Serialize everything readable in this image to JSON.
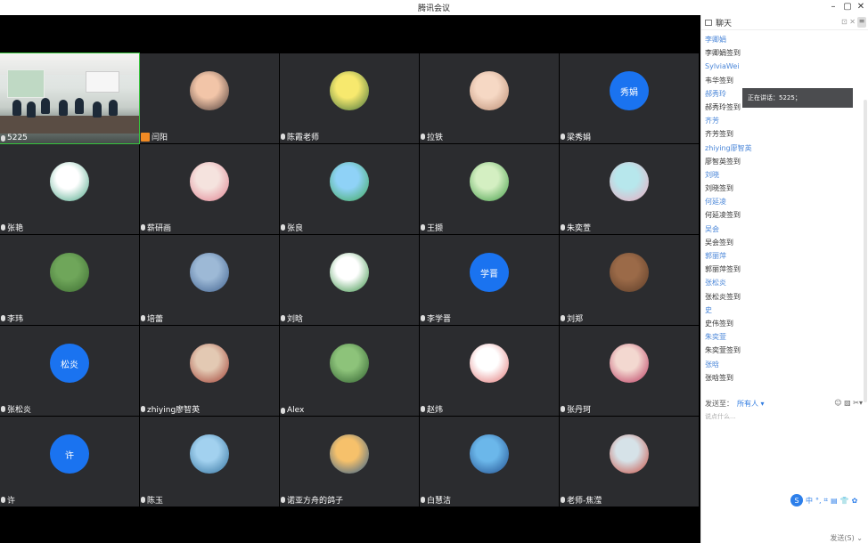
{
  "window": {
    "title": "腾讯会议",
    "min": "–",
    "max": "▢",
    "close": "✕"
  },
  "participants": [
    {
      "name": "5225",
      "kind": "camera"
    },
    {
      "name": "闫阳",
      "kind": "photo",
      "colors": [
        "#f2c5a8",
        "#4a3a37"
      ],
      "host": true
    },
    {
      "name": "陈霞老师",
      "kind": "photo",
      "colors": [
        "#f7e96e",
        "#3d6e3a"
      ]
    },
    {
      "name": "拉铁",
      "kind": "photo",
      "colors": [
        "#f6d8c4",
        "#b98b72"
      ]
    },
    {
      "name": "梁秀娟",
      "kind": "text",
      "text": "秀娟"
    },
    {
      "name": "张艳",
      "kind": "photo",
      "colors": [
        "#ffffff",
        "#45a483"
      ]
    },
    {
      "name": "薪研画",
      "kind": "photo",
      "colors": [
        "#f5e3de",
        "#e07e8e"
      ]
    },
    {
      "name": "张良",
      "kind": "photo",
      "colors": [
        "#8fd2f7",
        "#3da854"
      ]
    },
    {
      "name": "王撷",
      "kind": "photo",
      "colors": [
        "#d4efc2",
        "#3e9a43"
      ]
    },
    {
      "name": "朱奕萱",
      "kind": "photo",
      "colors": [
        "#b7e7ec",
        "#eea8be"
      ]
    },
    {
      "name": "李玮",
      "kind": "photo",
      "colors": [
        "#6fa65a",
        "#3b6b30"
      ]
    },
    {
      "name": "培蕾",
      "kind": "photo",
      "colors": [
        "#9db9d6",
        "#3d5f8d"
      ]
    },
    {
      "name": "刘晗",
      "kind": "photo",
      "colors": [
        "#ffffff",
        "#2f8c3c"
      ]
    },
    {
      "name": "李学晋",
      "kind": "text",
      "text": "学晋"
    },
    {
      "name": "刘郑",
      "kind": "photo",
      "colors": [
        "#9b6a48",
        "#5a3b27"
      ]
    },
    {
      "name": "张松炎",
      "kind": "text",
      "text": "松炎"
    },
    {
      "name": "zhiying廖智英",
      "kind": "photo",
      "colors": [
        "#e3c9b3",
        "#9e3a2f"
      ]
    },
    {
      "name": "Alex",
      "kind": "photo",
      "colors": [
        "#8dc37a",
        "#2c5c2c"
      ]
    },
    {
      "name": "赵炜",
      "kind": "photo",
      "colors": [
        "#ffffff",
        "#e06f6f"
      ]
    },
    {
      "name": "张丹珂",
      "kind": "photo",
      "colors": [
        "#f3d8d0",
        "#b8325a"
      ]
    },
    {
      "name": "许",
      "kind": "text",
      "text": "许"
    },
    {
      "name": "陈玉",
      "kind": "photo",
      "colors": [
        "#a2d1ef",
        "#2f6f9c"
      ]
    },
    {
      "name": "诺亚方舟的鸽子",
      "kind": "photo",
      "colors": [
        "#f6c16b",
        "#2a5b8c"
      ]
    },
    {
      "name": "白慧洁",
      "kind": "photo",
      "colors": [
        "#6bb7ea",
        "#1f4c8c"
      ]
    },
    {
      "name": "老师-焦滢",
      "kind": "photo",
      "colors": [
        "#d6e2e8",
        "#c94a3d"
      ]
    }
  ],
  "chat": {
    "header": "聊天",
    "tools": "⊡ ✕",
    "menu": "≡",
    "messages": [
      {
        "type": "sender",
        "text": "李卿娟"
      },
      {
        "type": "text",
        "text": "李卿娟签到"
      },
      {
        "type": "sender",
        "text": "SylviaWei"
      },
      {
        "type": "text",
        "text": "韦华签到"
      },
      {
        "type": "sender",
        "text": "郝秀玲"
      },
      {
        "type": "text",
        "text": "郝秀玲签到"
      },
      {
        "type": "sender",
        "text": "齐芳"
      },
      {
        "type": "text",
        "text": "齐芳签到"
      },
      {
        "type": "sender",
        "text": "zhiying廖智英"
      },
      {
        "type": "text",
        "text": "廖智英签到"
      },
      {
        "type": "sender",
        "text": "刘晓"
      },
      {
        "type": "text",
        "text": "刘晓签到"
      },
      {
        "type": "sender",
        "text": "何延凌"
      },
      {
        "type": "text",
        "text": "何延凌签到"
      },
      {
        "type": "sender",
        "text": "吴会"
      },
      {
        "type": "text",
        "text": "吴会签到"
      },
      {
        "type": "sender",
        "text": "郭丽萍"
      },
      {
        "type": "text",
        "text": "郭丽萍签到"
      },
      {
        "type": "sender",
        "text": "张松炎"
      },
      {
        "type": "text",
        "text": "张松炎签到"
      },
      {
        "type": "sender",
        "text": "史"
      },
      {
        "type": "text",
        "text": "史伟签到"
      },
      {
        "type": "sender",
        "text": "朱奕萱"
      },
      {
        "type": "text",
        "text": "朱奕萱签到"
      },
      {
        "type": "sender",
        "text": "张晗"
      },
      {
        "type": "text",
        "text": "张晗签到"
      }
    ],
    "speaking_toast": "正在讲话：5225；",
    "send_to_label": "发送至：",
    "send_to_target": "所有人 ▾",
    "send_tools": "☺ ▨ ✂▾",
    "input_placeholder": "说点什么...",
    "send_button": "发送(S) ⌄",
    "ime": {
      "logo": "S",
      "items": [
        "中",
        "°,",
        "⌗",
        "▤",
        "👕",
        "✿"
      ]
    }
  }
}
